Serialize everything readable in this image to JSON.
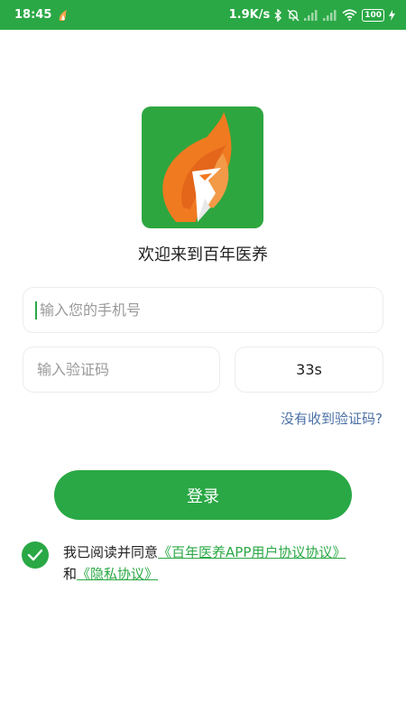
{
  "status_bar": {
    "time": "18:45",
    "network_speed": "1.9K/s",
    "battery_level": "100",
    "icons": [
      "app-notification-icon",
      "bluetooth-icon",
      "mute-icon",
      "signal-icon",
      "signal-icon",
      "wifi-icon",
      "battery-icon",
      "charging-icon"
    ]
  },
  "welcome_text": "欢迎来到百年医养",
  "phone_input": {
    "placeholder": "输入您的手机号",
    "value": ""
  },
  "code_input": {
    "placeholder": "输入验证码",
    "value": ""
  },
  "countdown_label": "33s",
  "no_code_link": "没有收到验证码?",
  "login_label": "登录",
  "agreement": {
    "prefix": "我已阅读并同意",
    "user_agreement_link": "《百年医养APP用户协议协议》",
    "conjunction": "和",
    "privacy_link": "《隐私协议》",
    "checked": true
  },
  "colors": {
    "primary": "#2aa845",
    "link_blue": "#4a6fa5"
  }
}
